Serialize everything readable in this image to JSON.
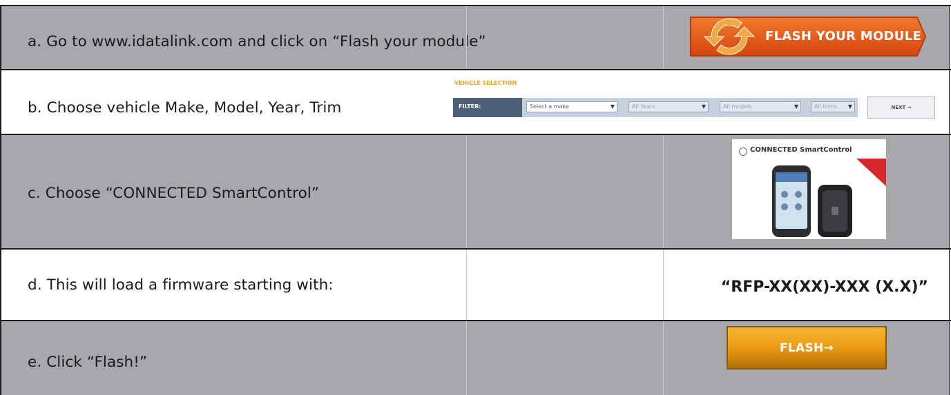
{
  "steps": [
    {
      "label": "a. Go to www.idatalink.com and click on “Flash your module”"
    },
    {
      "label": "b. Choose vehicle Make, Model, Year, Trim"
    },
    {
      "label": "c. Choose “CONNECTED SmartControl”"
    },
    {
      "label": "d. This will load a firmware starting with:"
    },
    {
      "label": "e. Click “Flash!”"
    }
  ],
  "flash_module_button": {
    "label": "FLASH YOUR MODULE",
    "colors": {
      "orange": "#e5581a",
      "icon": "#f0a43a"
    }
  },
  "vehicle_selection": {
    "title": "VEHICLE SELECTION",
    "filter_label": "FILTER:",
    "make_select": "Select a make",
    "year_select": "All Years",
    "model_select": "All models",
    "trim_select": "All trims",
    "next_label": "NEXT →"
  },
  "connected_option": {
    "label": "CONNECTED SmartControl"
  },
  "firmware": {
    "code": "“RFP-XX(XX)-XXX (X.X)”"
  },
  "flash_button": {
    "label": "FLASH→",
    "color": "#ec9a14"
  },
  "colors": {
    "row_gray": "#a7a8ac",
    "row_white": "#ffffff",
    "border": "#1c1c1c"
  }
}
